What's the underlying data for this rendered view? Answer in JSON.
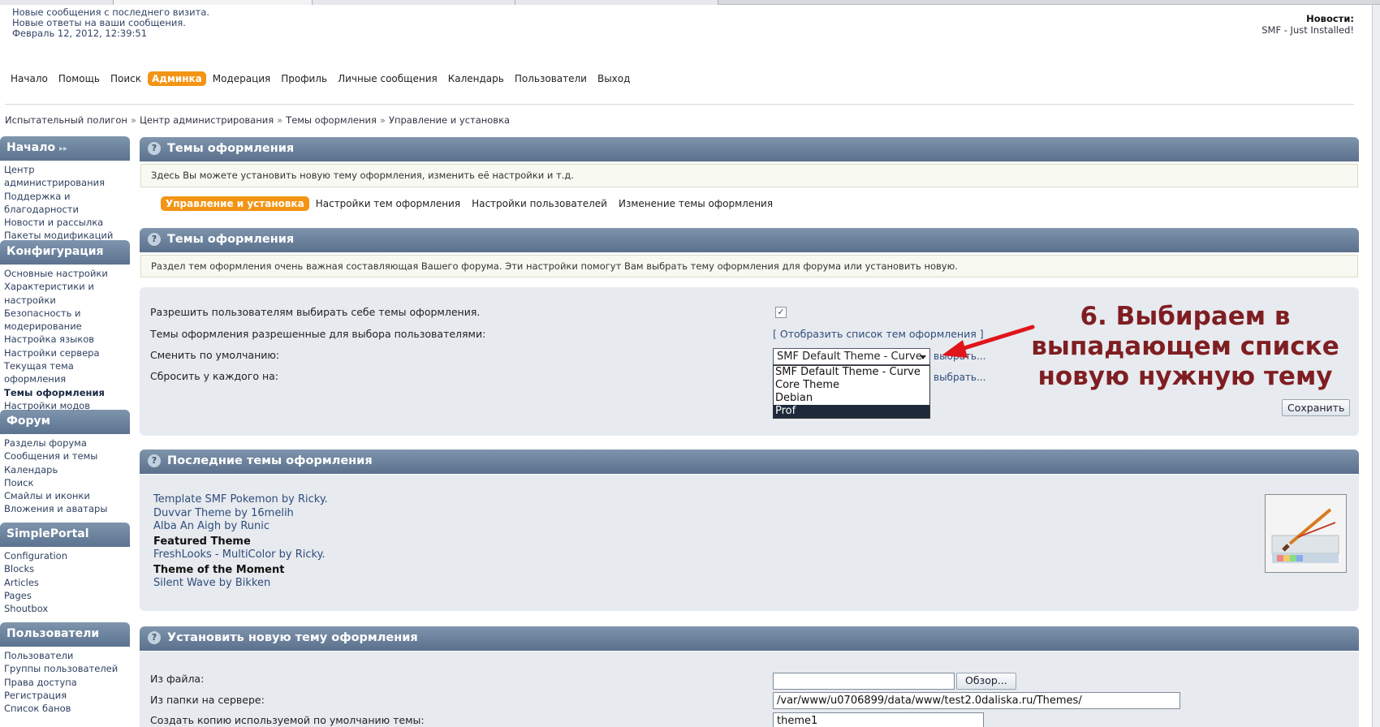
{
  "header": {
    "user_lines": [
      "Новые сообщения с последнего визита.",
      "Новые ответы на ваши сообщения.",
      "Февраль 12, 2012, 12:39:51"
    ],
    "news_title": "Новости:",
    "news_text": "SMF - Just Installed!"
  },
  "nav": {
    "items": [
      "Начало",
      "Помощь",
      "Поиск",
      "Админка",
      "Модерация",
      "Профиль",
      "Личные сообщения",
      "Календарь",
      "Пользователи",
      "Выход"
    ],
    "active": "Админка"
  },
  "breadcrumb": [
    "Испытательный полигон",
    "Центр администрирования",
    "Темы оформления",
    "Управление и установка"
  ],
  "breadcrumb_sep": "»",
  "sidebar": [
    {
      "title": "Начало",
      "items": [
        "Центр администрирования",
        "Поддержка и благодарности",
        "Новости и рассылка",
        "Пакеты модификаций"
      ]
    },
    {
      "title": "Конфигурация",
      "items": [
        "Основные настройки",
        "Характеристики и настройки",
        "Безопасность и модерирование",
        "Настройка языков",
        "Настройки сервера",
        "Текущая тема оформления",
        "Темы оформления",
        "Настройки модов"
      ]
    },
    {
      "title": "Форум",
      "items": [
        "Разделы форума",
        "Сообщения и темы",
        "Календарь",
        "Поиск",
        "Смайлы и иконки",
        "Вложения и аватары"
      ]
    },
    {
      "title": "SimplePortal",
      "items": [
        "Configuration",
        "Blocks",
        "Articles",
        "Pages",
        "Shoutbox"
      ]
    },
    {
      "title": "Пользователи",
      "items": [
        "Пользователи",
        "Группы пользователей",
        "Права доступа",
        "Регистрация",
        "Список банов"
      ]
    }
  ],
  "sidebar_current": "Темы оформления",
  "main": {
    "panel1_title": "Темы оформления",
    "panel1_desc": "Здесь Вы можете установить новую тему оформления, изменить её настройки и т.д.",
    "subtabs": [
      "Управление и установка",
      "Настройки тем оформления",
      "Настройки пользователей",
      "Изменение темы оформления"
    ],
    "subtab_active": "Управление и установка",
    "panel2_title": "Темы оформления",
    "panel2_desc": "Раздел тем оформления очень важная составляющая Вашего форума. Эти настройки помогут Вам выбрать тему оформления для форума или установить новую.",
    "settings": {
      "allow_label": "Разрешить пользователям выбирать себе темы оформления.",
      "allowed_label": "Темы оформления разрешенные для выбора пользователями:",
      "allowed_link": "[ Отобразить список тем оформления ]",
      "default_label": "Сменить по умолчанию:",
      "reset_label": "Сбросить у каждого на:",
      "select_value": "SMF Default Theme - Curve",
      "options": [
        "SMF Default Theme - Curve",
        "Core Theme",
        "Debian",
        "Prof"
      ],
      "highlighted_option": "Prof",
      "choose_text_1": "выбрать...",
      "choose_text_2": "выбрать...",
      "save_button": "Сохранить"
    },
    "annotation": "6. Выбираем в выпадающем списке новую нужную тему",
    "latest_title": "Последние темы оформления",
    "latest_links": [
      "Template SMF Pokemon by Ricky.",
      "Duvvar Theme by 16melih",
      "Alba An Aigh by Runic"
    ],
    "featured_label": "Featured Theme",
    "featured_link": "FreshLooks - MultiColor by Ricky.",
    "moment_label": "Theme of the Moment",
    "moment_link": "Silent Wave by Bikken",
    "install_title": "Установить новую тему оформления",
    "from_file_label": "Из файла:",
    "browse_button": "Обзор...",
    "from_dir_label": "Из папки на сервере:",
    "dir_value": "/var/www/u0706899/data/www/test2.0daliska.ru/Themes/",
    "copy_label": "Создать копию используемой по умолчанию темы:",
    "copy_value": "theme1"
  },
  "colors": {
    "accent": "#f39414",
    "panel_head": "#6a819c",
    "annotation": "#7f1e22",
    "arrow": "#e0141b"
  }
}
